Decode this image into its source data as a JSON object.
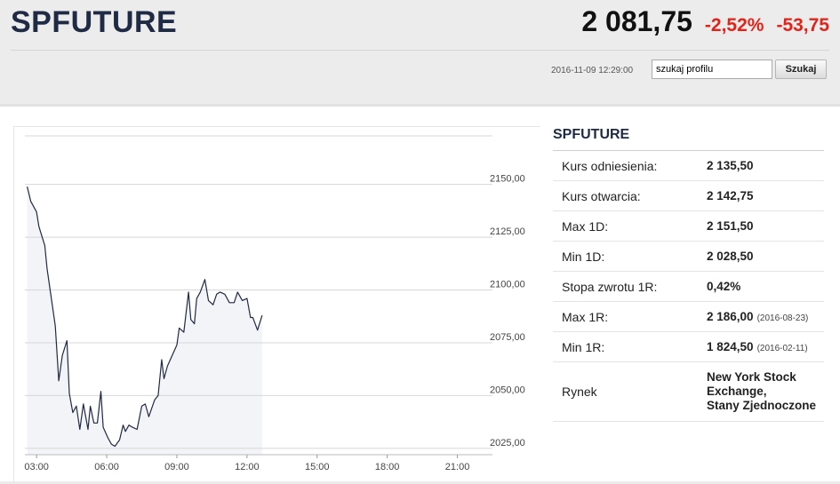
{
  "header": {
    "symbol": "SPFUTURE",
    "price": "2 081,75",
    "change_pct": "-2,52%",
    "change_abs": "-53,75",
    "timestamp": "2016-11-09 12:29:00",
    "search_value": "szukaj profilu",
    "search_button": "Szukaj"
  },
  "colors": {
    "negative": "#e2231a",
    "title": "#1f2a44",
    "line": "#1f2a44",
    "area": "#f2f4f7",
    "grid": "#d7d7d7"
  },
  "info": {
    "title": "SPFUTURE",
    "rows": [
      {
        "label": "Kurs odniesienia:",
        "value": "2 135,50",
        "date": ""
      },
      {
        "label": "Kurs otwarcia:",
        "value": "2 142,75",
        "date": ""
      },
      {
        "label": "Max 1D:",
        "value": "2 151,50",
        "date": ""
      },
      {
        "label": "Min 1D:",
        "value": "2 028,50",
        "date": ""
      },
      {
        "label": "Stopa zwrotu 1R:",
        "value": "0,42%",
        "date": ""
      },
      {
        "label": "Max 1R:",
        "value": "2 186,00",
        "date": "(2016-08-23)"
      },
      {
        "label": "Min 1R:",
        "value": "1 824,50",
        "date": "(2016-02-11)"
      }
    ],
    "market_label": "Rynek",
    "market_lines": [
      "New York Stock",
      "Exchange,",
      "Stany Zjednoczone"
    ]
  },
  "chart_data": {
    "type": "area",
    "x_ticks": [
      "03:00",
      "06:00",
      "09:00",
      "12:00",
      "15:00",
      "18:00",
      "21:00"
    ],
    "x_tick_hours": [
      3,
      6,
      9,
      12,
      15,
      18,
      21
    ],
    "xlim": [
      2.5,
      22.5
    ],
    "y_ticks": [
      2025,
      2050,
      2075,
      2100,
      2125,
      2150
    ],
    "y_tick_labels": [
      "2025,00",
      "2050,00",
      "2075,00",
      "2100,00",
      "2125,00",
      "2150,00"
    ],
    "ylim": [
      2022,
      2173
    ],
    "grid": true,
    "series": [
      {
        "x": [
          2.6,
          2.75,
          3.0,
          3.1,
          3.35,
          3.45,
          3.8,
          3.95,
          4.1,
          4.3,
          4.4,
          4.55,
          4.7,
          4.85,
          5.0,
          5.2,
          5.3,
          5.45,
          5.6,
          5.75,
          5.85,
          6.05,
          6.2,
          6.35,
          6.55,
          6.7,
          6.8,
          6.95,
          7.1,
          7.3,
          7.5,
          7.65,
          7.8,
          8.05,
          8.2,
          8.35,
          8.45,
          8.6,
          8.8,
          9.0,
          9.1,
          9.3,
          9.5,
          9.6,
          9.75,
          9.85,
          10.0,
          10.2,
          10.35,
          10.55,
          10.7,
          10.85,
          11.05,
          11.25,
          11.45,
          11.6,
          11.8,
          12.0,
          12.15,
          12.25,
          12.45,
          12.65
        ],
        "y": [
          2149,
          2142,
          2137,
          2130,
          2121,
          2110,
          2083,
          2057,
          2069,
          2076,
          2051,
          2042,
          2045,
          2034,
          2046,
          2034,
          2045,
          2037,
          2037,
          2052,
          2035,
          2030,
          2027,
          2026,
          2029,
          2036,
          2033,
          2036,
          2035,
          2034,
          2045,
          2046,
          2040,
          2048,
          2050,
          2067,
          2058,
          2064,
          2069,
          2074,
          2082,
          2080,
          2099,
          2086,
          2084,
          2096,
          2099,
          2105,
          2095,
          2093,
          2098,
          2099,
          2098,
          2094,
          2094,
          2099,
          2095,
          2096,
          2087,
          2087,
          2081,
          2088
        ]
      }
    ]
  }
}
